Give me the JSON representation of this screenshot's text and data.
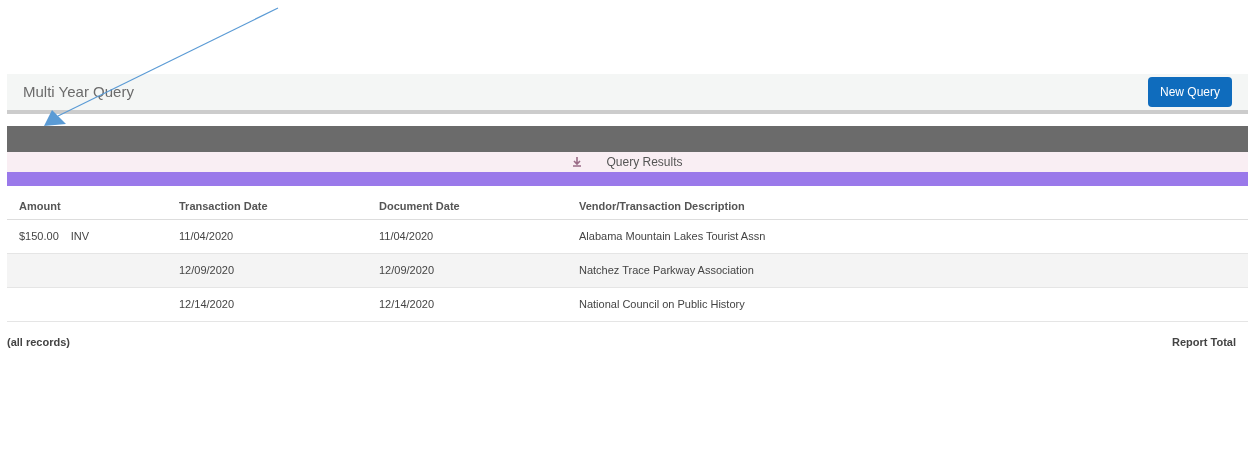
{
  "page": {
    "title": "Multi Year Query",
    "new_query_button": "New Query"
  },
  "results": {
    "title": "Query Results",
    "columns": [
      "Amount",
      "Transaction Date",
      "Document Date",
      "Vendor/Transaction Description"
    ],
    "rows": [
      {
        "amount": "$150.00",
        "type": "INV",
        "transaction_date": "11/04/2020",
        "document_date": "11/04/2020",
        "vendor": "Alabama Mountain Lakes Tourist Assn"
      },
      {
        "transaction_date": "12/09/2020",
        "document_date": "12/09/2020",
        "vendor": "Natchez Trace Parkway Association"
      },
      {
        "transaction_date": "12/14/2020",
        "document_date": "12/14/2020",
        "vendor": "National Council on Public History"
      }
    ],
    "footer": {
      "scope": "(all records)",
      "total_label": "Report Total"
    }
  }
}
